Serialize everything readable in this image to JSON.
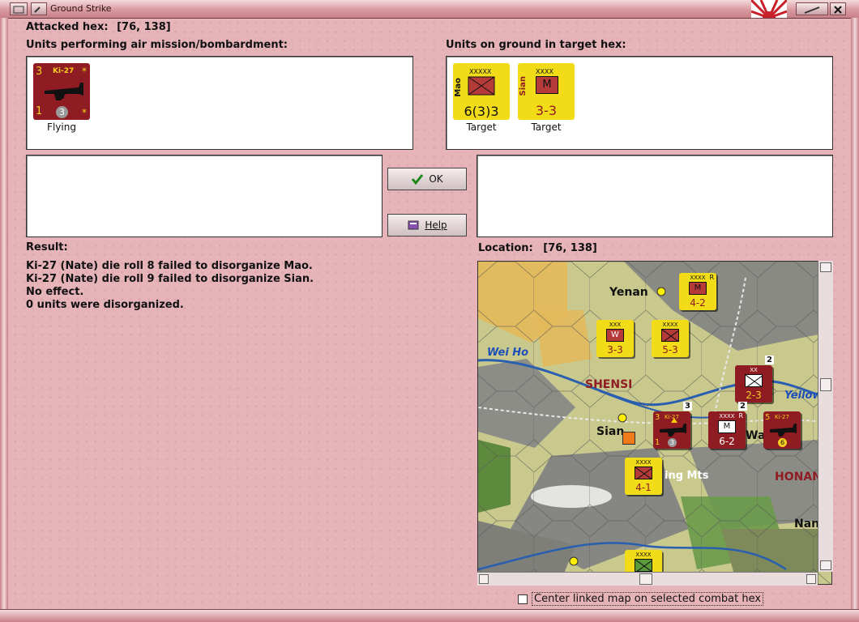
{
  "window": {
    "title": "Ground Strike"
  },
  "attacked_hex": {
    "label": "Attacked hex:",
    "value": "[76, 138]"
  },
  "air_units": {
    "header": "Units performing air mission/bombardment:",
    "units": [
      {
        "name": "Ki-27",
        "top_left": "3",
        "bottom_left": "1",
        "center_badge": "3",
        "corner": "*",
        "status": "Flying"
      }
    ]
  },
  "ground_units": {
    "header": "Units on ground in target hex:",
    "units": [
      {
        "name": "Mao",
        "size": "XXXXX",
        "strength": "6(3)3",
        "status": "Target"
      },
      {
        "name": "Sian",
        "size": "XXXX",
        "type_letter": "M",
        "strength": "3-3",
        "status": "Target"
      }
    ]
  },
  "buttons": {
    "ok": "OK",
    "help": "Help"
  },
  "result": {
    "label": "Result:",
    "lines": [
      "Ki-27 (Nate) die roll 8 failed to disorganize Mao.",
      "Ki-27 (Nate) die roll 9 failed to disorganize Sian.",
      "No effect.",
      "0 units were disorganized."
    ]
  },
  "location": {
    "label": "Location:",
    "value": "[76, 138]"
  },
  "map": {
    "places": {
      "yenan": "Yenan",
      "wei_ho": "Wei Ho",
      "shensi": "SHENSI",
      "sian": "Sian",
      "ing_mts": "ing Mts",
      "honan": "HONAN",
      "yellow": "Yellow",
      "nan": "Nan",
      "wa": "Wa"
    },
    "counters": {
      "c1": {
        "size": "XXXX",
        "tag": "R",
        "letter": "M",
        "strength": "4-2"
      },
      "c2": {
        "size": "XXX",
        "letter": "W",
        "strength": "3-3"
      },
      "c3": {
        "size": "XXXX",
        "strength": "5-3"
      },
      "c4": {
        "size": "XX",
        "stack": "2",
        "strength": "2-3"
      },
      "c5": {
        "name": "Ki-27",
        "top_left": "3",
        "bottom_left": "1",
        "badge": "3",
        "stack": "3"
      },
      "c6": {
        "size": "XXXX",
        "tag": "R",
        "letter": "M",
        "strength": "6-2",
        "stack": "2"
      },
      "c7": {
        "name": "Ki-27",
        "top_left": "5",
        "badge": "6"
      },
      "c8": {
        "size": "XXXX",
        "strength": "4-1"
      },
      "c9": {
        "size": "XXXX"
      }
    }
  },
  "center_map_checkbox": {
    "label": "Center linked map on selected combat hex",
    "checked": false
  },
  "colors": {
    "window_bg": "#e5b3b8",
    "axis_red": "#8f1c22",
    "chinese_yellow": "#f2dc18",
    "river_blue": "#2a5fb0"
  }
}
